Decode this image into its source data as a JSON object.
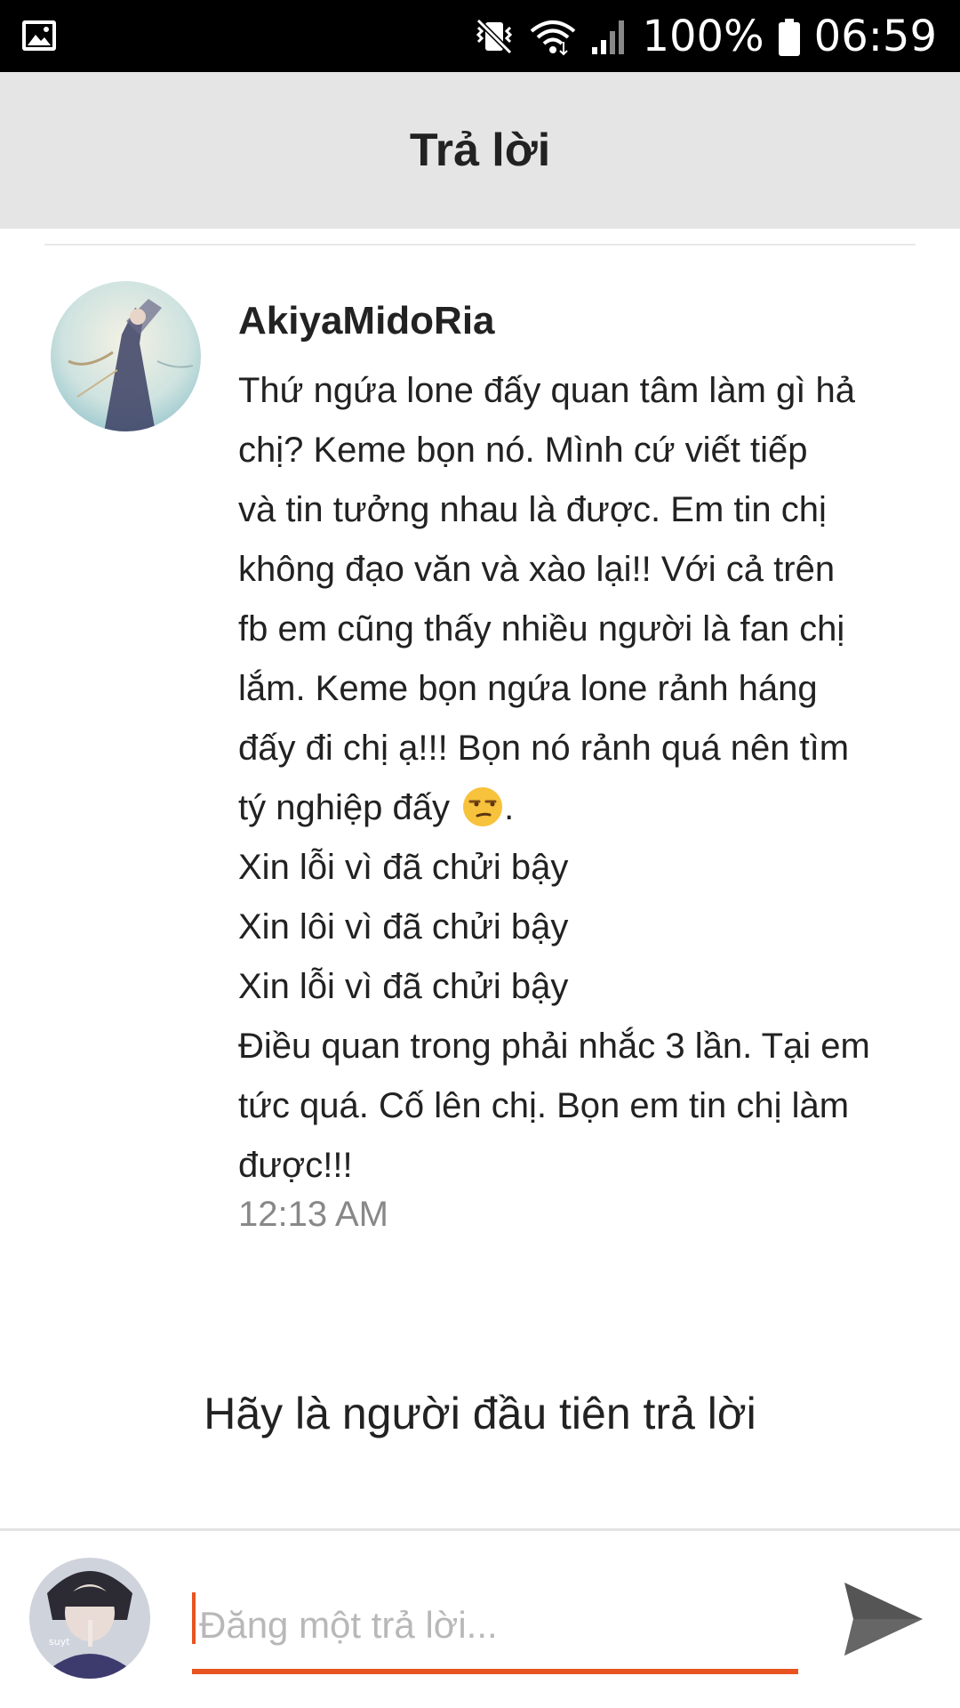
{
  "status_bar": {
    "battery_percent": "100%",
    "time": "06:59",
    "icons": [
      "gallery-icon",
      "vibrate-mute-icon",
      "wifi-icon",
      "signal-icon",
      "battery-icon"
    ]
  },
  "header": {
    "title": "Trả lời"
  },
  "post": {
    "author": "AkiyaMidoRia",
    "lines": [
      "Thứ ngứa lone đấy quan tâm làm gì hả",
      "chị? Keme bọn nó. Mình cứ viết tiếp",
      "và tin tưởng nhau là được. Em tin chị",
      "không đạo văn và xào lại!! Với cả trên",
      "fb em cũng thấy nhiều người là fan chị",
      "lắm. Keme bọn ngứa lone rảnh háng",
      "đấy đi chị ạ!!! Bọn nó rảnh quá nên tìm",
      "tý nghiệp đấy",
      "Xin lỗi vì đã chửi bậy",
      "Xin lôi vì đã chửi bậy",
      "Xin lỗi vì đã chửi bậy",
      "Điều quan trong phải nhắc 3 lần. Tại em",
      "tức quá. Cố lên chị. Bọn em tin chị làm",
      "được!!!"
    ],
    "emoji_suffix": ".",
    "emoji": "unamused-face-emoji",
    "time": "12:13 AM"
  },
  "empty_state": {
    "text": "Hãy là người đầu tiên trả lời"
  },
  "reply": {
    "placeholder": "Đăng một trả lời...",
    "value": ""
  },
  "colors": {
    "accent": "#e8531f",
    "header_bg": "#e5e5e5",
    "status_bg": "#000000",
    "send_icon": "#555555"
  }
}
